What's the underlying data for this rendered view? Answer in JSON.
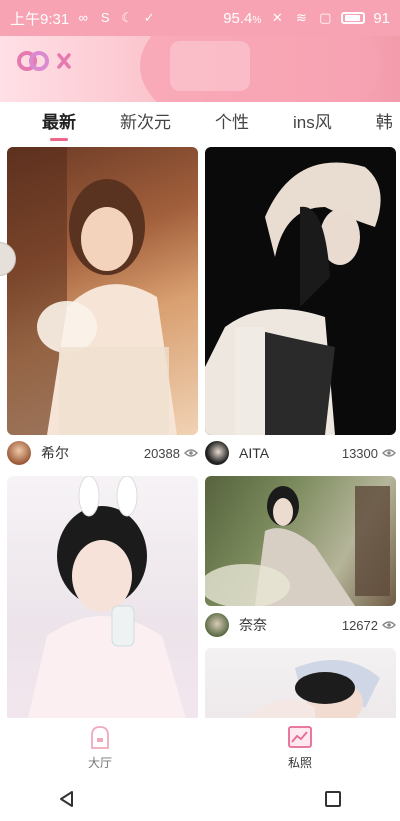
{
  "status_bar": {
    "time": "上午9:31",
    "battery_pct": "95.4",
    "battery_level": "91"
  },
  "tabs": [
    {
      "label": "最新",
      "active": true
    },
    {
      "label": "新次元",
      "active": false
    },
    {
      "label": "个性",
      "active": false
    },
    {
      "label": "ins风",
      "active": false
    },
    {
      "label": "韩",
      "active": false
    }
  ],
  "feed": [
    {
      "name": "希尔",
      "views": "20388"
    },
    {
      "name": "AITA",
      "views": "13300"
    },
    {
      "name": "奈奈",
      "views": "12672"
    }
  ],
  "bottom_nav": {
    "hall_label": "大厅",
    "photos_label": "私照"
  },
  "colors": {
    "accent": "#ee6688",
    "header_pink": "#f7a3b3"
  }
}
